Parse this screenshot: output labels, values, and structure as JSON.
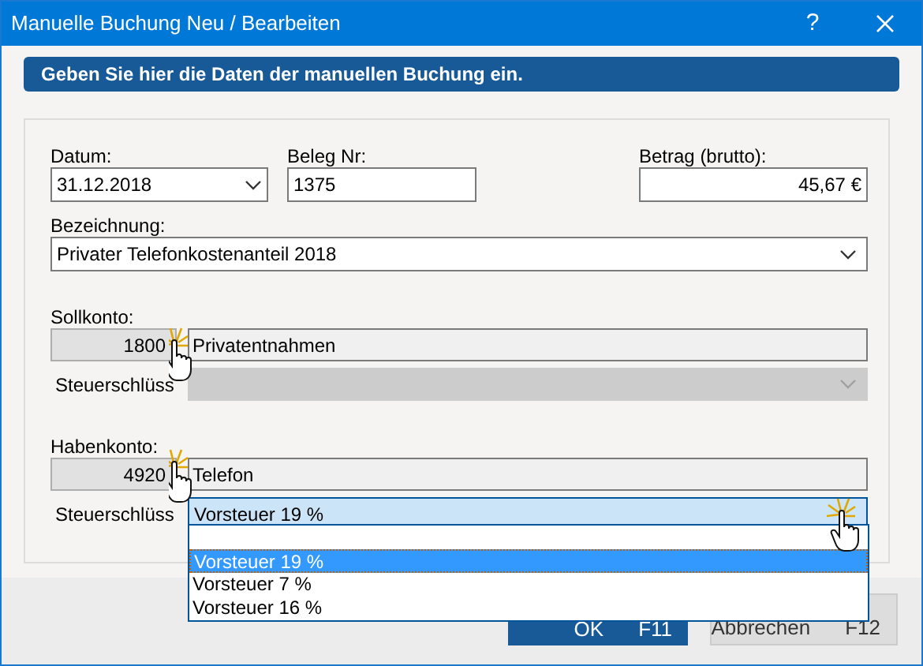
{
  "window": {
    "title": "Manuelle Buchung Neu / Bearbeiten",
    "help": "?"
  },
  "banner": "Geben Sie hier die Daten der manuellen Buchung ein.",
  "datum": {
    "label": "Datum:",
    "value": "31.12.2018"
  },
  "beleg": {
    "label": "Beleg Nr:",
    "value": "1375"
  },
  "betrag": {
    "label": "Betrag (brutto):",
    "value": "45,67 €"
  },
  "bezeichnung": {
    "label": "Bezeichnung:",
    "value": "Privater Telefonkostenanteil 2018"
  },
  "accounts": [
    {
      "label": "Sollkonto:",
      "number": "1800",
      "name": "Privatentnahmen",
      "tax_label": "Steuerschlüss",
      "tax_disabled": true,
      "tax_expanded": false
    },
    {
      "label": "Habenkonto:",
      "number": "4920",
      "name": "Telefon",
      "tax_label": "Steuerschlüss",
      "tax_value": "Vorsteuer 19 %",
      "tax_disabled": false,
      "tax_expanded": true
    }
  ],
  "dropdown": [
    {
      "label": "Vorsteuer 19 %",
      "selected": true
    },
    {
      "label": "Vorsteuer 7 %",
      "selected": false
    },
    {
      "label": "Vorsteuer 16 %",
      "selected": false
    }
  ],
  "buttons": [
    {
      "label": "OK",
      "shortcut": "F11",
      "kind": "primary"
    },
    {
      "label": "Abbrechen",
      "shortcut": "F12",
      "kind": "secondary"
    }
  ]
}
